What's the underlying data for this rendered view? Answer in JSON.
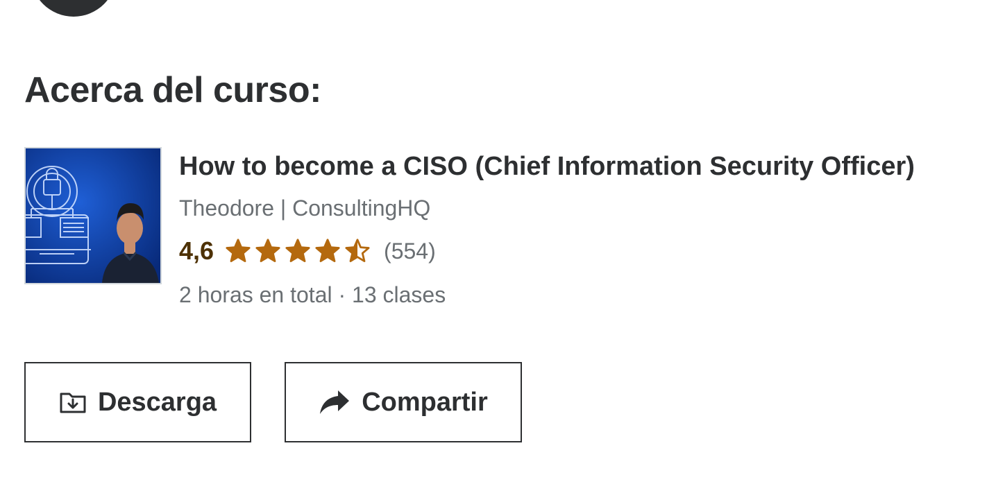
{
  "section": {
    "title": "Acerca del curso:"
  },
  "course": {
    "title": "How to become a CISO (Chief Information Security Officer)",
    "instructor": "Theodore | ConsultingHQ",
    "rating": {
      "value_text": "4,6",
      "value": 4.6,
      "max": 5,
      "count_text": "(554)",
      "star_color": "#b4690e"
    },
    "meta": "2 horas en total · 13 clases",
    "thumbnail": {
      "icon": "security-lock-network-illustration",
      "background": "#0b3aa0"
    }
  },
  "actions": {
    "download_label": "Descarga",
    "download_icon": "folder-download-icon",
    "share_label": "Compartir",
    "share_icon": "share-arrow-icon"
  }
}
